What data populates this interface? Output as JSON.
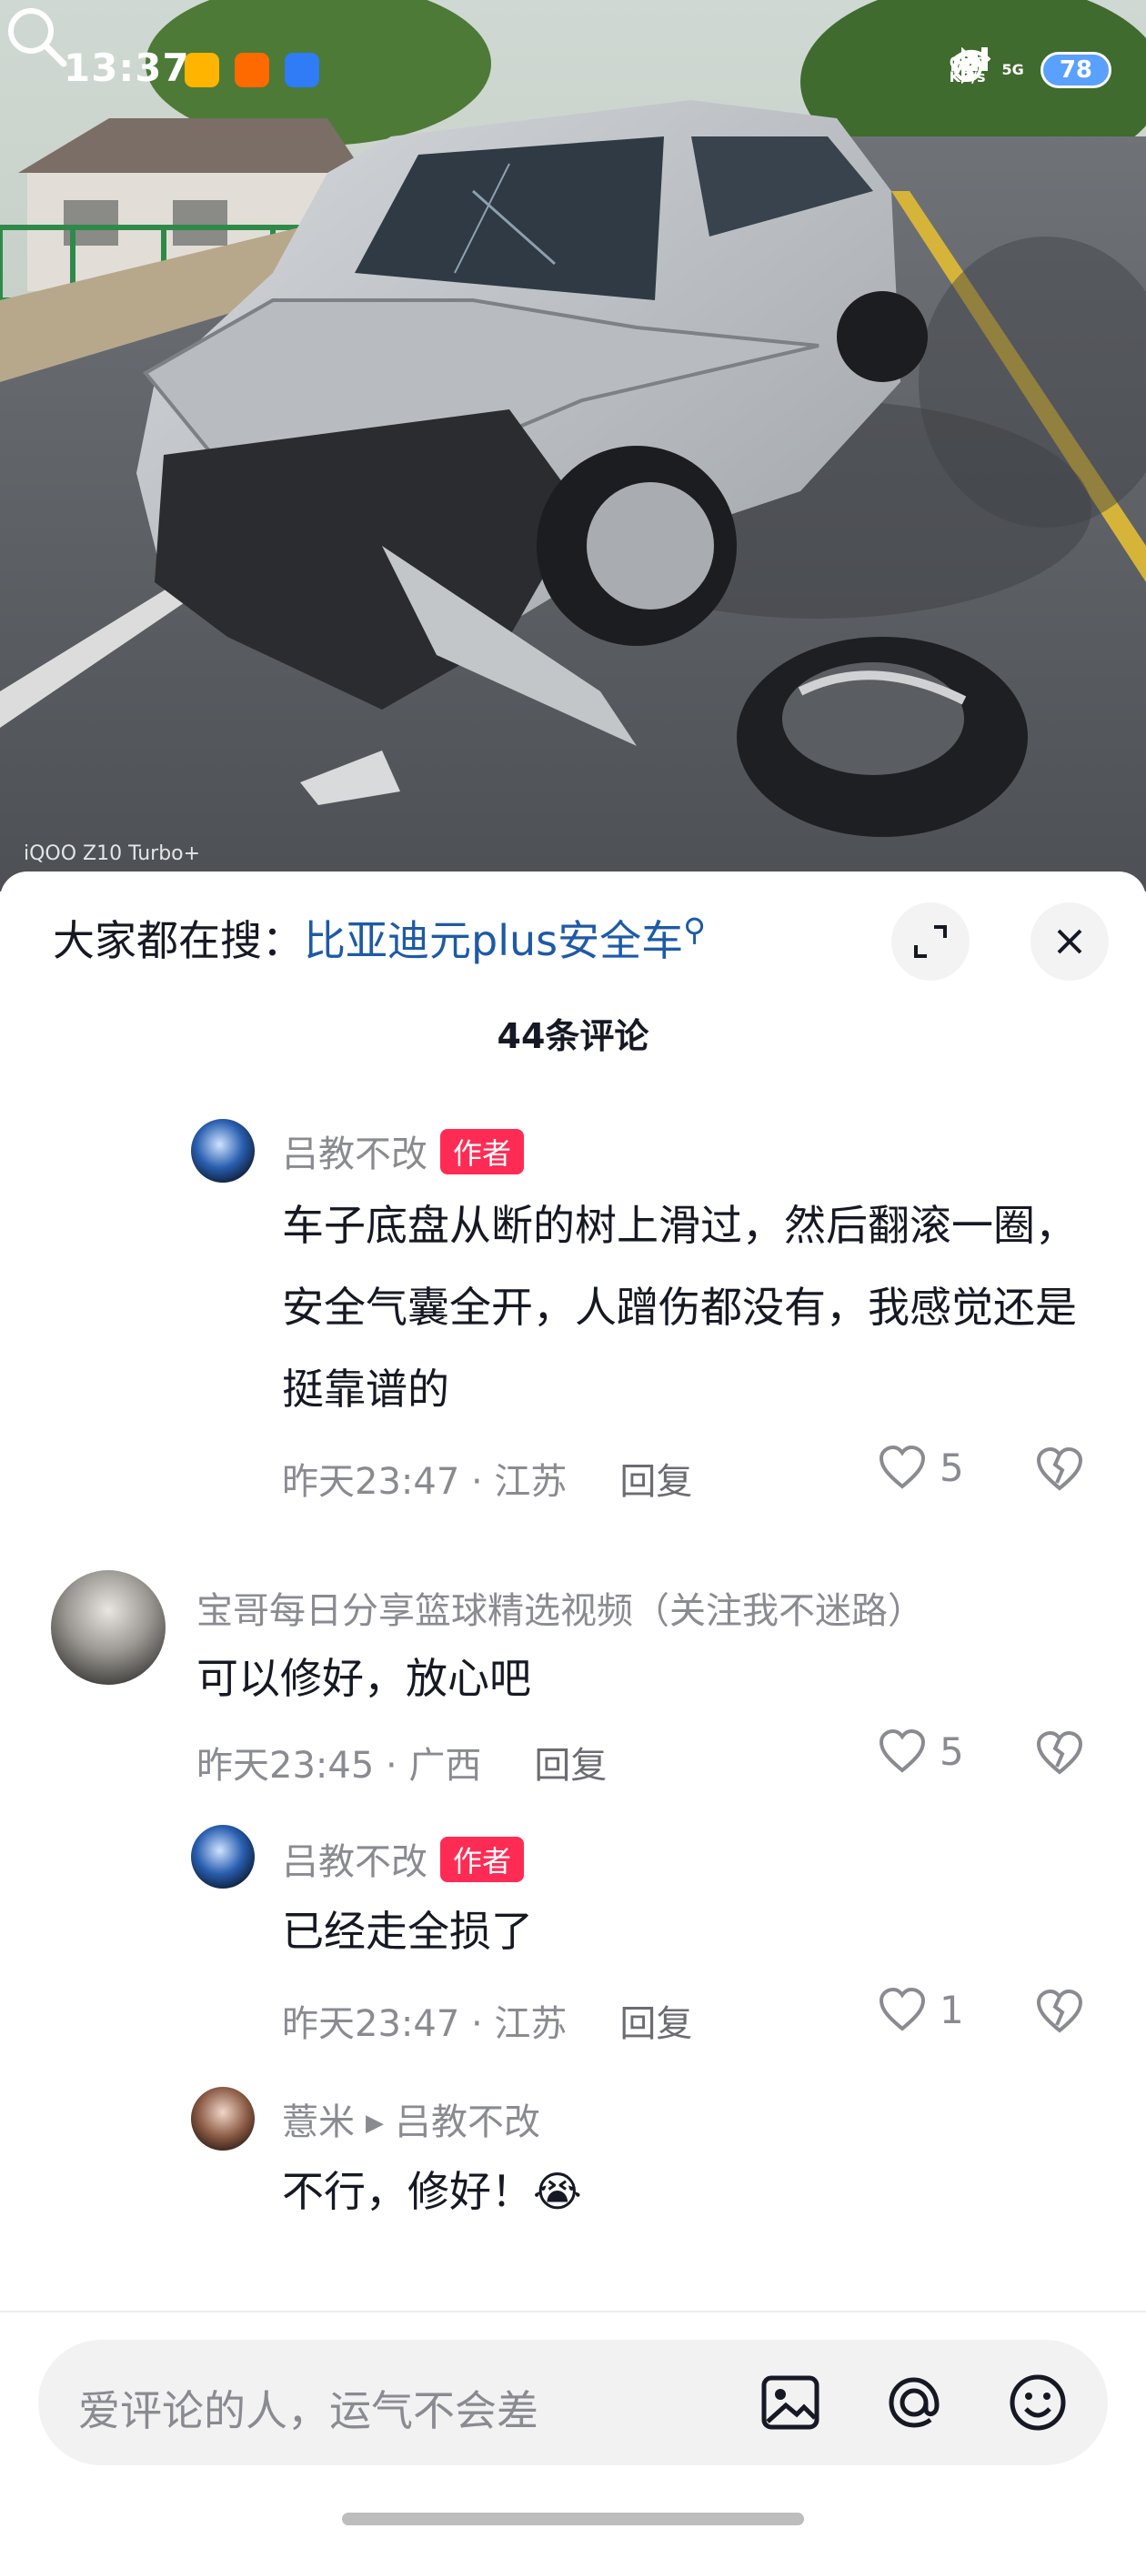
{
  "status_bar": {
    "time": "13:37",
    "net_speed_value": "0.60",
    "net_speed_unit": "KB/s",
    "network_type": "5G",
    "battery": "78"
  },
  "photo": {
    "watermark": "iQOO Z10 Turbo+"
  },
  "sheet": {
    "hot_search_prefix": "大家都在搜：",
    "hot_search_keyword": "比亚迪元plus安全车",
    "comment_count": "44条评论"
  },
  "comments": [
    {
      "user": "吕教不改",
      "tag": "作者",
      "text": "车子底盘从断的树上滑过，然后翻滚一圈，安全气囊全开，人蹭伤都没有，我感觉还是挺靠谱的",
      "time_loc": "昨天23:47 · 江苏",
      "reply": "回复",
      "likes": "5"
    },
    {
      "user": "宝哥每日分享篮球精选视频（关注我不迷路）",
      "text": "可以修好，放心吧",
      "time_loc": "昨天23:45 · 广西",
      "reply": "回复",
      "likes": "5"
    },
    {
      "user": "吕教不改",
      "tag": "作者",
      "text": "已经走全损了",
      "time_loc": "昨天23:47 · 江苏",
      "reply": "回复",
      "likes": "1"
    },
    {
      "user": "薏米",
      "reply_to": "吕教不改",
      "text": "不行，修好！",
      "emoji": "😭"
    }
  ],
  "input": {
    "placeholder": "爱评论的人，运气不会差"
  },
  "colors": {
    "author_tag": "#fe2c55",
    "hot_keyword": "#1e5aa6",
    "meta_gray": "#8a8b91"
  }
}
